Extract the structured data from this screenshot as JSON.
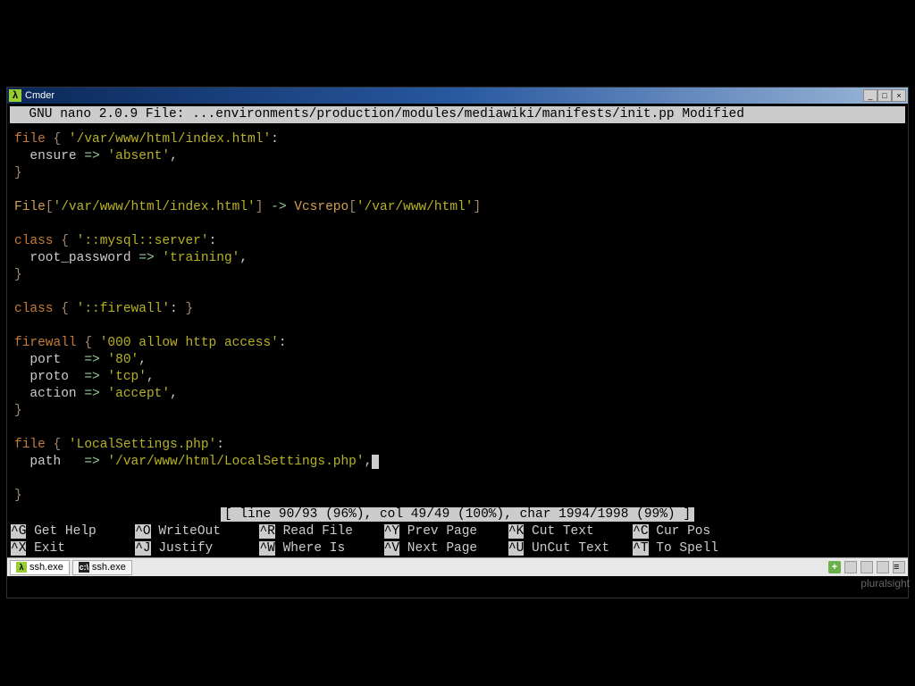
{
  "window": {
    "title": "Cmder"
  },
  "nano": {
    "header": "  GNU nano 2.0.9 File: ...environments/production/modules/mediawiki/manifests/init.pp Modified  ",
    "status": "[ line 90/93 (96%), col 49/49 (100%), char 1994/1998 (99%) ]"
  },
  "code": {
    "l1_a": "file ",
    "l1_b": "{",
    "l1_c": " '/var/www/html/index.html'",
    "l1_d": ":",
    "l2_a": "  ensure ",
    "l2_b": "=>",
    "l2_c": " 'absent'",
    "l2_d": ",",
    "l3_a": "}",
    "l5_a": "File",
    "l5_b": "[",
    "l5_c": "'/var/www/html/index.html'",
    "l5_d": "] ",
    "l5_e": "->",
    "l5_f": " Vcsrepo",
    "l5_g": "[",
    "l5_h": "'/var/www/html'",
    "l5_i": "]",
    "l7_a": "class ",
    "l7_b": "{",
    "l7_c": " '::mysql::server'",
    "l7_d": ":",
    "l8_a": "  root_password ",
    "l8_b": "=>",
    "l8_c": " 'training'",
    "l8_d": ",",
    "l9_a": "}",
    "l11_a": "class ",
    "l11_b": "{",
    "l11_c": " '::firewall'",
    "l11_d": ": ",
    "l11_e": "}",
    "l13_a": "firewall ",
    "l13_b": "{",
    "l13_c": " '000 allow http access'",
    "l13_d": ":",
    "l14_a": "  port   ",
    "l14_b": "=>",
    "l14_c": " '80'",
    "l14_d": ",",
    "l15_a": "  proto  ",
    "l15_b": "=>",
    "l15_c": " 'tcp'",
    "l15_d": ",",
    "l16_a": "  action ",
    "l16_b": "=>",
    "l16_c": " 'accept'",
    "l16_d": ",",
    "l17_a": "}",
    "l19_a": "file ",
    "l19_b": "{",
    "l19_c": " 'LocalSettings.php'",
    "l19_d": ":",
    "l20_a": "  path   ",
    "l20_b": "=>",
    "l20_c": " '/var/www/html/LocalSettings.php'",
    "l20_d": ",",
    "l22_a": "}"
  },
  "shortcuts": {
    "r1": {
      "k1": "^G",
      "t1": " Get Help     ",
      "k2": "^O",
      "t2": " WriteOut     ",
      "k3": "^R",
      "t3": " Read File    ",
      "k4": "^Y",
      "t4": " Prev Page    ",
      "k5": "^K",
      "t5": " Cut Text     ",
      "k6": "^C",
      "t6": " Cur Pos"
    },
    "r2": {
      "k1": "^X",
      "t1": " Exit         ",
      "k2": "^J",
      "t2": " Justify      ",
      "k3": "^W",
      "t3": " Where Is     ",
      "k4": "^V",
      "t4": " Next Page    ",
      "k5": "^U",
      "t5": " UnCut Text   ",
      "k6": "^T",
      "t6": " To Spell"
    }
  },
  "tabs": {
    "t1": "ssh.exe",
    "t2": "ssh.exe"
  },
  "watermark": "pluralsight"
}
